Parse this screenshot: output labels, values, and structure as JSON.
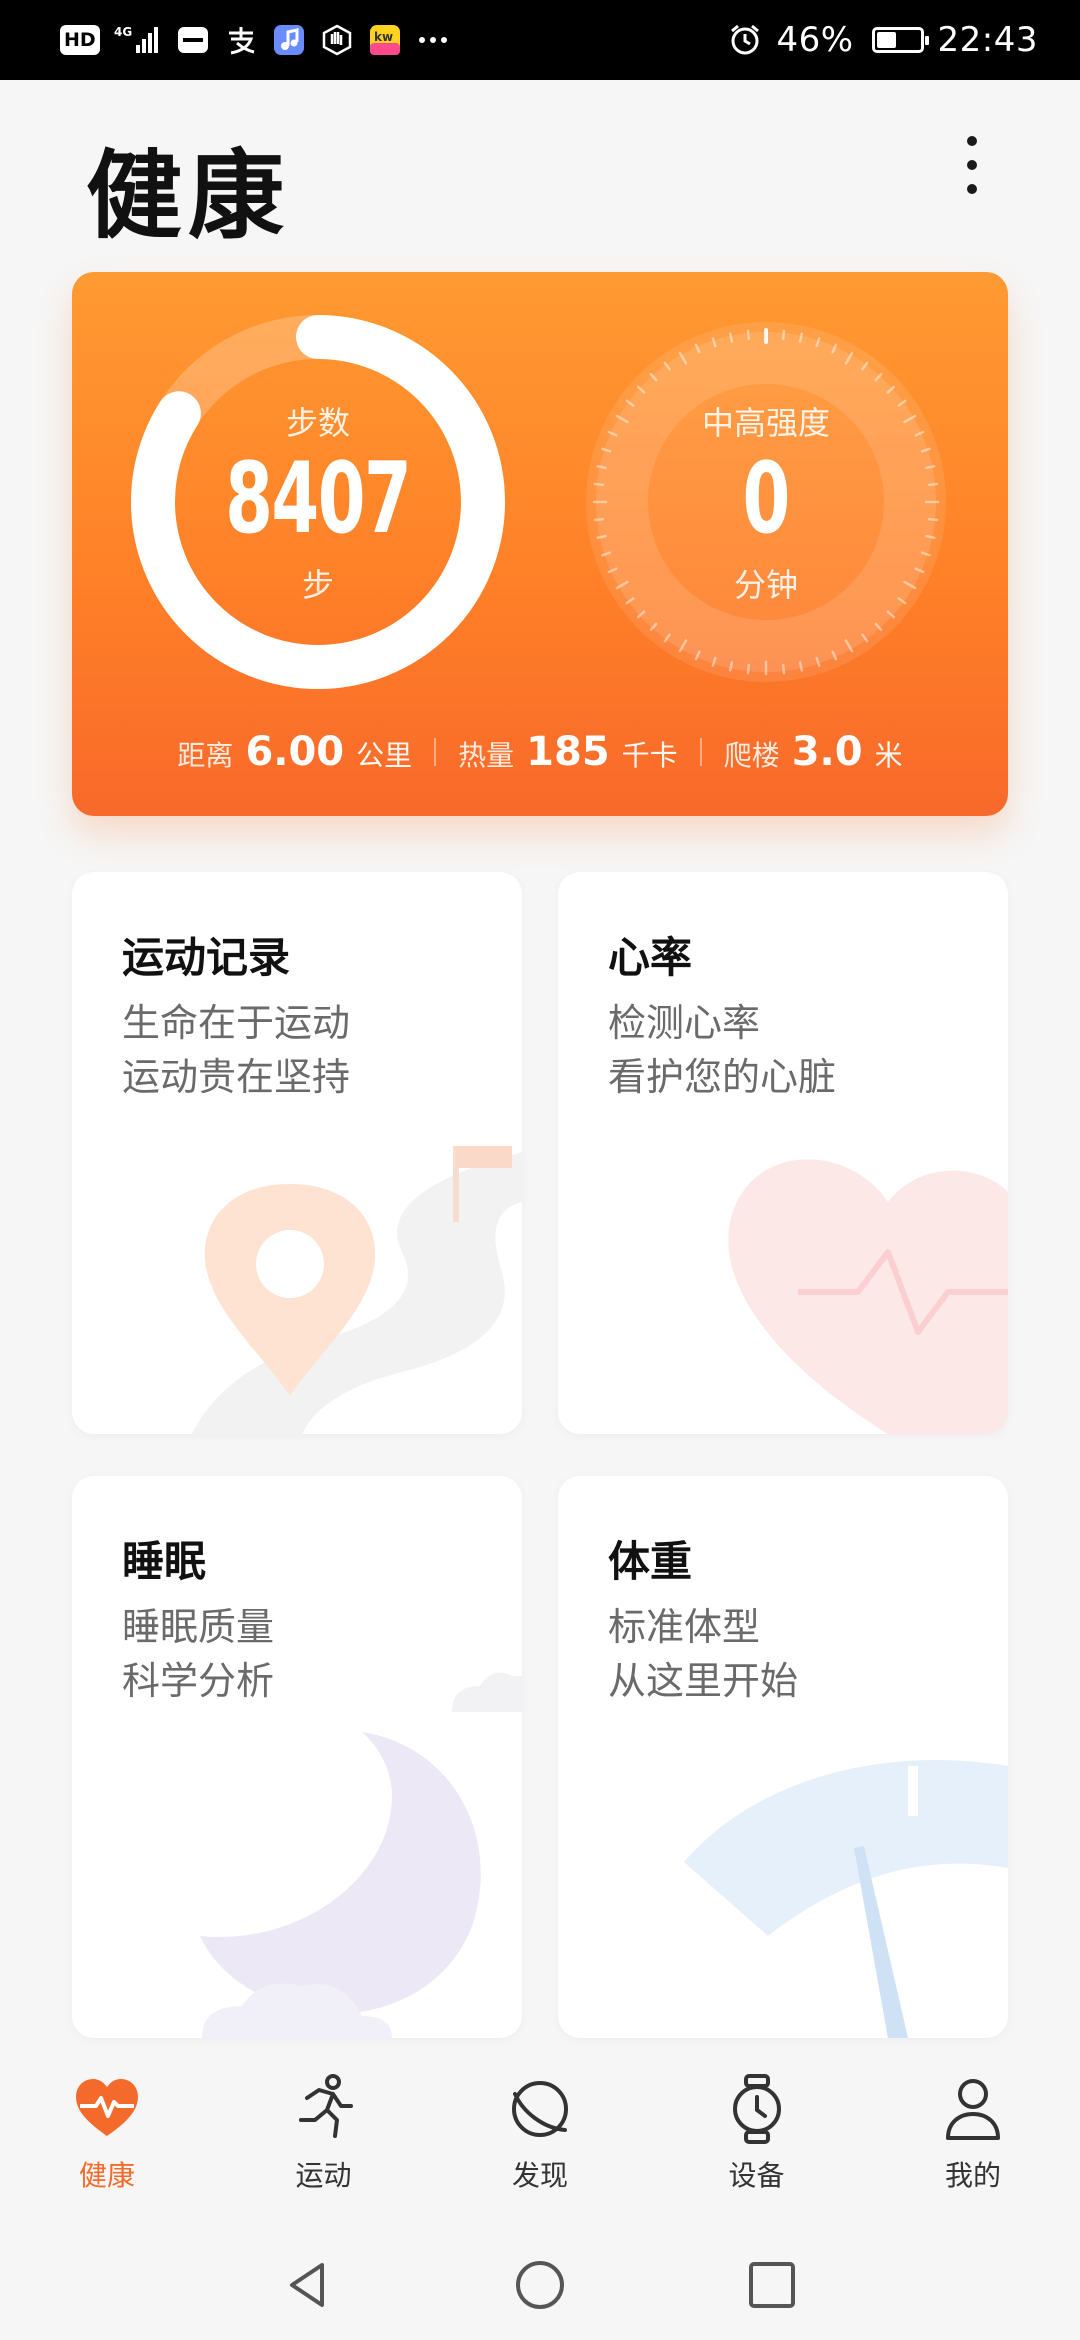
{
  "status_bar": {
    "left_icons": [
      "hd-badge",
      "signal-4g-icon",
      "huawei-app-icon",
      "alipay-icon",
      "music-app-icon",
      "hand-icon",
      "kuwo-app-icon",
      "more-dots-icon"
    ],
    "hd": "HD",
    "network": "4G",
    "battery_percent": "46%",
    "battery_level": 0.46,
    "time": "22:43"
  },
  "header": {
    "title": "健康"
  },
  "activity": {
    "steps_label": "步数",
    "steps_value": "8407",
    "steps_unit": "步",
    "steps_progress": 0.84,
    "intensity_label": "中高强度",
    "intensity_value": "0",
    "intensity_unit": "分钟",
    "distance_label": "距离",
    "distance_value": "6.00",
    "distance_unit": "公里",
    "calories_label": "热量",
    "calories_value": "185",
    "calories_unit": "千卡",
    "climb_label": "爬楼",
    "climb_value": "3.0",
    "climb_unit": "米"
  },
  "cards": {
    "exercise": {
      "title": "运动记录",
      "line1": "生命在于运动",
      "line2": "运动贵在坚持"
    },
    "heart": {
      "title": "心率",
      "line1": "检测心率",
      "line2": "看护您的心脏"
    },
    "sleep": {
      "title": "睡眠",
      "line1": "睡眠质量",
      "line2": "科学分析"
    },
    "weight": {
      "title": "体重",
      "line1": "标准体型",
      "line2": "从这里开始"
    }
  },
  "bottom_nav": {
    "health": "健康",
    "exercise": "运动",
    "discover": "发现",
    "devices": "设备",
    "me": "我的"
  },
  "colors": {
    "accent": "#f46a2a",
    "card_orange_top": "#ff9a32",
    "card_orange_bottom": "#f8692a"
  }
}
